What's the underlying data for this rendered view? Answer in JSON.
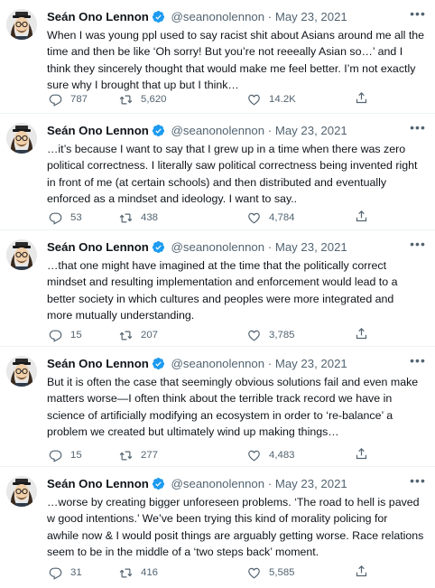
{
  "author": {
    "name": "Seán Ono Lennon",
    "handle": "@seanonolennon",
    "separator": "·"
  },
  "icons": {
    "avatar": "avatar-icon",
    "verified": "verified-badge-icon",
    "more": "more-icon",
    "reply": "reply-icon",
    "retweet": "retweet-icon",
    "like": "heart-icon",
    "share": "share-icon"
  },
  "colors": {
    "verified": "#1d9bf0",
    "text": "#0f1419",
    "muted": "#536471",
    "divider": "#eff3f4"
  },
  "tweets": [
    {
      "date": "May 23, 2021",
      "lines": [
        "When I was young ppl used to say racist shit about Asians around me all the",
        "time and then be like ‘Oh sorry! But you’re not reeeally Asian so…’ and I",
        "think they sincerely thought that would make me feel better. I’m not exactly",
        "sure why I brought that up but I think…"
      ],
      "replies": "787",
      "retweets": "5,620",
      "likes": "14.2K"
    },
    {
      "date": "May 23, 2021",
      "lines": [
        "…it’s because I want to say that I grew up in a time when there was zero",
        "political correctness. I literally saw political correctness being invented right",
        "in front of me (at certain schools) and then distributed and eventually",
        "enforced as a mindset and ideology. I want to say.."
      ],
      "replies": "53",
      "retweets": "438",
      "likes": "4,784"
    },
    {
      "date": "May 23, 2021",
      "lines": [
        "…that one might have imagined at the time that the politically correct",
        "mindset and resulting implementation and enforcement would lead to a",
        "better society in which cultures and peoples were more integrated and",
        "more mutually understanding."
      ],
      "replies": "15",
      "retweets": "207",
      "likes": "3,785"
    },
    {
      "date": "May 23, 2021",
      "lines": [
        "But it is often the case that seemingly obvious solutions fail and even make",
        "matters worse—I often think about the terrible track record we have in",
        "science of artificially modifying an ecosystem in order to ‘re-balance’ a",
        "problem we created but ultimately wind up making things…"
      ],
      "replies": "15",
      "retweets": "277",
      "likes": "4,483"
    },
    {
      "date": "May 23, 2021",
      "lines": [
        "…worse by creating bigger unforeseen problems. ‘The road to hell is paved",
        "w good intentions.’ We’ve been trying this kind of morality policing for",
        "awhile now & I would posit things are arguably getting worse. Race relations",
        "seem to be in the middle of a ‘two steps back’ moment."
      ],
      "replies": "31",
      "retweets": "416",
      "likes": "5,585"
    }
  ]
}
